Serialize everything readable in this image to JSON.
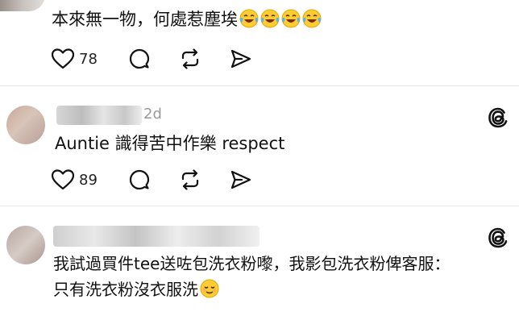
{
  "posts": [
    {
      "text": "本來無一物，何處惹塵埃",
      "emojis": [
        "tears-of-joy-emoji",
        "tears-of-joy-emoji",
        "tears-of-joy-emoji",
        "tears-of-joy-emoji"
      ],
      "likes": "78"
    },
    {
      "time": "2d",
      "text": "Auntie 識得苦中作樂 respect",
      "likes": "89"
    },
    {
      "text_line1": "我試過買件tee送咗包洗衣粉嚟，我影包洗衣粉俾客服：",
      "text_line2": "只有洗衣粉沒衣服洗",
      "emoji": "relieved-face-emoji"
    }
  ],
  "icons": {
    "like": "heart-icon",
    "reply": "comment-icon",
    "repost": "repost-icon",
    "share": "send-icon",
    "brand": "threads-logo-icon"
  }
}
